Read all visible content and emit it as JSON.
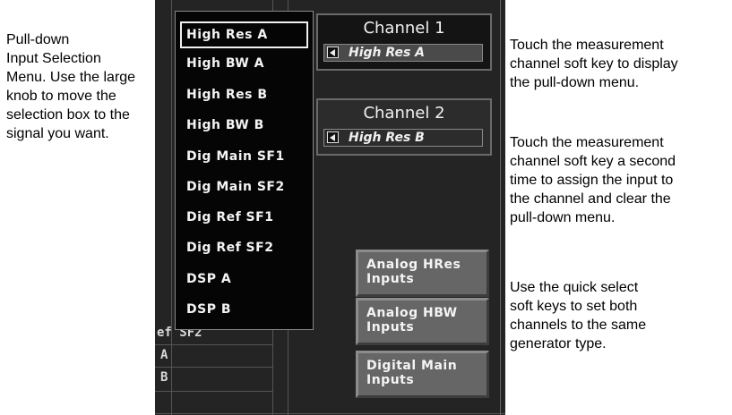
{
  "captions": {
    "left": "Pull-down\nInput Selection\nMenu. Use the large\nknob to move the\nselection box to the\nsignal you want.",
    "right_1": "Touch the measurement\nchannel soft key to display\nthe pull-down menu.",
    "right_2": "Touch the measurement\nchannel soft key a second\ntime to assign the input to\nthe channel and clear the\npull-down menu.",
    "right_3": "Use the quick select\nsoft keys to set both\nchannels to the same\ngenerator type."
  },
  "menu": {
    "items": [
      "High Res A",
      "High BW A",
      "High Res B",
      "High BW B",
      "Dig Main SF1",
      "Dig Main SF2",
      "Dig Ref SF1",
      "Dig Ref SF2",
      "DSP A",
      "DSP B"
    ],
    "selected_index": 0
  },
  "channels": [
    {
      "title": "Channel 1",
      "value": "High Res A",
      "active": true
    },
    {
      "title": "Channel 2",
      "value": "High Res B",
      "active": false
    }
  ],
  "quick_select": [
    "Analog HRes\nInputs",
    "Analog HBW\nInputs",
    "Digital Main\nInputs"
  ],
  "background_fragments": [
    "ef SF2",
    "A",
    "B"
  ],
  "colors": {
    "screen_bg": "#242424",
    "menu_bg": "#050505",
    "button_bg": "#666666",
    "text": "#f4f4f4"
  }
}
